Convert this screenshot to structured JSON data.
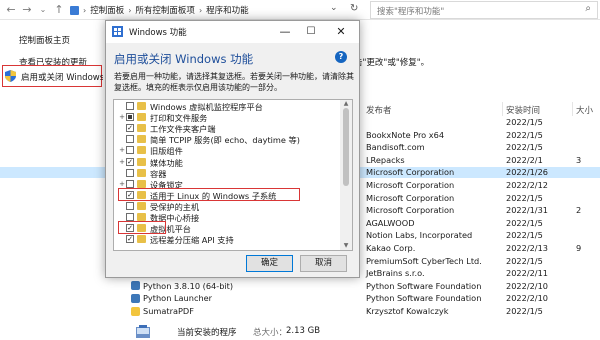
{
  "address_bar": {
    "crumbs": [
      "控制面板",
      "所有控制面板项",
      "程序和功能"
    ],
    "search_placeholder": "搜索\"程序和功能\""
  },
  "left_pane": {
    "home_link": "控制面板主页",
    "updates_link": "查看已安装的更新",
    "features_link": "启用或关闭 Windows 功能"
  },
  "main": {
    "description_fragment": "击\"更改\"或\"修复\"。",
    "columns": {
      "publisher": "发布者",
      "installed_on": "安装时间",
      "size": "大小"
    },
    "rows": [
      {
        "name": "",
        "publisher": "",
        "date": "2022/1/5",
        "size": "",
        "selected": false
      },
      {
        "name": "",
        "publisher": "BookxNote Pro x64",
        "date": "2022/1/5",
        "size": "",
        "selected": false
      },
      {
        "name": "",
        "publisher": "Bandisoft.com",
        "date": "2022/1/5",
        "size": "",
        "selected": false
      },
      {
        "name": "",
        "publisher": "LRepacks",
        "date": "2022/2/1",
        "size": "3",
        "selected": false
      },
      {
        "name": "",
        "publisher": "Microsoft Corporation",
        "date": "2022/1/26",
        "size": "",
        "selected": true
      },
      {
        "name": "",
        "publisher": "Microsoft Corporation",
        "date": "2022/2/12",
        "size": "",
        "selected": false
      },
      {
        "name": "",
        "publisher": "Microsoft Corporation",
        "date": "2022/1/5",
        "size": "",
        "selected": false
      },
      {
        "name": "",
        "publisher": "Microsoft Corporation",
        "date": "2022/1/31",
        "size": "2",
        "selected": false
      },
      {
        "name": "",
        "publisher": "AGALWOOD",
        "date": "2022/1/5",
        "size": "",
        "selected": false
      },
      {
        "name": "",
        "publisher": "Notion Labs, Incorporated",
        "date": "2022/1/5",
        "size": "",
        "selected": false
      },
      {
        "name": "",
        "publisher": "Kakao Corp.",
        "date": "2022/2/13",
        "size": "9",
        "selected": false
      },
      {
        "name": "",
        "publisher": "PremiumSoft CyberTech Ltd.",
        "date": "2022/1/5",
        "size": "",
        "selected": false
      },
      {
        "name": "",
        "publisher": "JetBrains s.r.o.",
        "date": "2022/2/11",
        "size": "",
        "selected": false
      },
      {
        "name": "Python 3.8.10 (64-bit)",
        "publisher": "Python Software Foundation",
        "date": "2022/2/10",
        "size": "",
        "selected": false
      },
      {
        "name": "Python Launcher",
        "publisher": "Python Software Foundation",
        "date": "2022/2/10",
        "size": "",
        "selected": false
      },
      {
        "name": "SumatraPDF",
        "publisher": "Krzysztof Kowalczyk",
        "date": "2022/1/5",
        "size": "",
        "selected": false
      }
    ],
    "status": {
      "label": "当前安装的程序",
      "total_label": "总大小：",
      "total": "2.13 GB"
    }
  },
  "dialog": {
    "title": "Windows 功能",
    "heading": "启用或关闭 Windows 功能",
    "help": "?",
    "description": "若要启用一种功能，请选择其复选框。若要关闭一种功能，请清除其复选框。填充的框表示仅启用该功能的一部分。",
    "features": [
      {
        "label": "Windows 虚拟机监控程序平台",
        "state": "unchecked",
        "expandable": false
      },
      {
        "label": "打印和文件服务",
        "state": "partial",
        "expandable": true
      },
      {
        "label": "工作文件夹客户端",
        "state": "checked",
        "expandable": false
      },
      {
        "label": "简单 TCPIP 服务(即 echo、daytime 等)",
        "state": "unchecked",
        "expandable": false
      },
      {
        "label": "旧版组件",
        "state": "unchecked",
        "expandable": true
      },
      {
        "label": "媒体功能",
        "state": "checked",
        "expandable": true
      },
      {
        "label": "容器",
        "state": "unchecked",
        "expandable": false
      },
      {
        "label": "设备锁定",
        "state": "unchecked",
        "expandable": true
      },
      {
        "label": "适用于 Linux 的 Windows 子系统",
        "state": "checked",
        "expandable": false
      },
      {
        "label": "受保护的主机",
        "state": "unchecked",
        "expandable": false
      },
      {
        "label": "数据中心桥接",
        "state": "unchecked",
        "expandable": false
      },
      {
        "label": "虚拟机平台",
        "state": "checked",
        "expandable": false
      },
      {
        "label": "远程差分压缩 API 支持",
        "state": "checked",
        "expandable": false
      }
    ],
    "ok_label": "确定",
    "cancel_label": "取消"
  },
  "colors": {
    "highlight_red": "#d93636",
    "selection_blue": "#cce8ff",
    "heading_blue": "#1e4e9a",
    "folder_yellow": "#e8c048"
  }
}
